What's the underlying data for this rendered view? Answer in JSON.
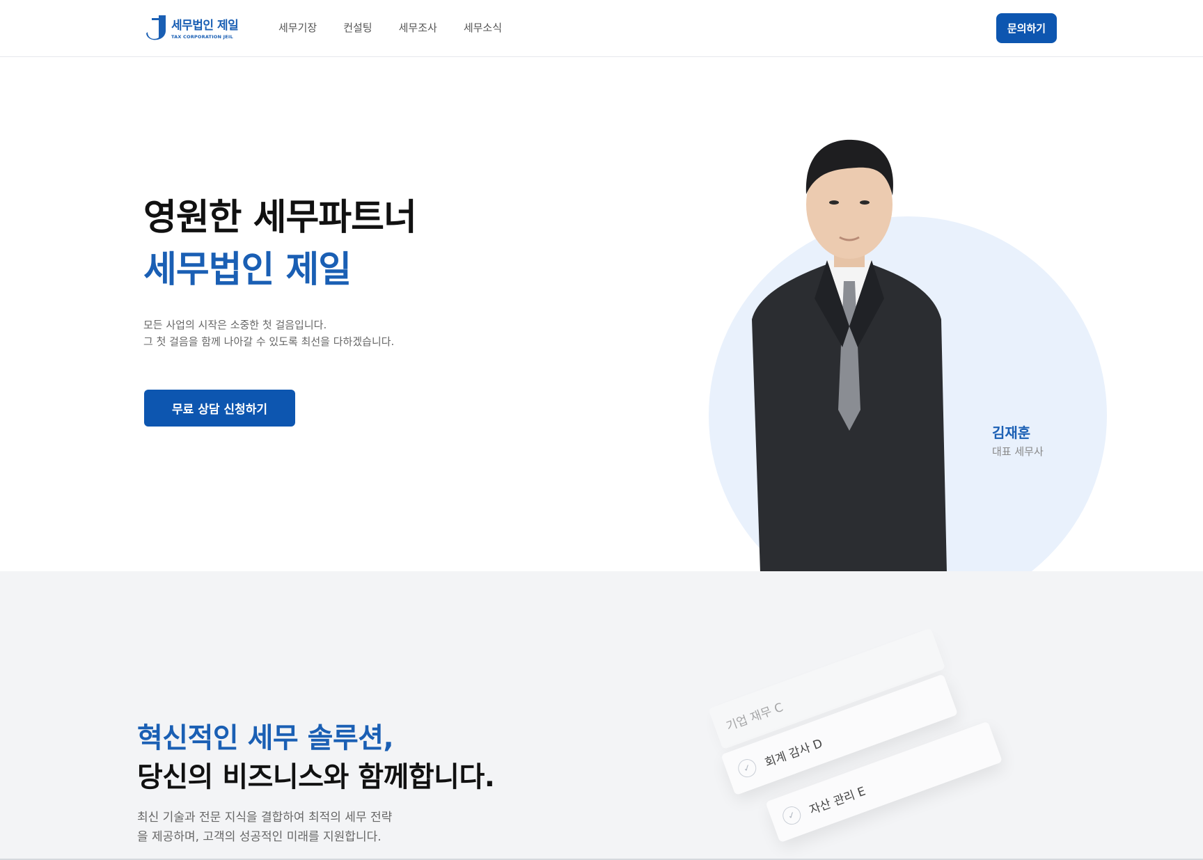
{
  "header": {
    "logo_title": "세무법인 제일",
    "logo_sub": "TAX CORPORATION JEIL",
    "nav": [
      "세무기장",
      "컨설팅",
      "세무조사",
      "세무소식"
    ],
    "cta_label": "문의하기"
  },
  "hero": {
    "title_line1": "영원한 세무파트너",
    "title_line2": "세무법인 제일",
    "desc_line1": "모든 사업의 시작은 소중한 첫 걸음입니다.",
    "desc_line2": "그 첫 걸음을 함께 나아갈 수 있도록 최선을 다하겠습니다.",
    "cta_label": "무료 상담 신청하기",
    "person_name": "김재훈",
    "person_role": "대표 세무사"
  },
  "section2": {
    "title_line1": "혁신적인 세무 솔루션,",
    "title_line2": "당신의 비즈니스와 함께합니다.",
    "desc_line1": "최신 기술과 전문 지식을 결합하여 최적의 세무 전략",
    "desc_line2": "을 제공하며, 고객의 성공적인 미래를 지원합니다.",
    "cards": [
      "기업 재무 C",
      "회계 감사 D",
      "자산 관리 E"
    ]
  },
  "colors": {
    "brand": "#1a5fb4",
    "button": "#0d56b0",
    "circle": "#e9f1fc",
    "section_bg": "#f3f4f6"
  }
}
